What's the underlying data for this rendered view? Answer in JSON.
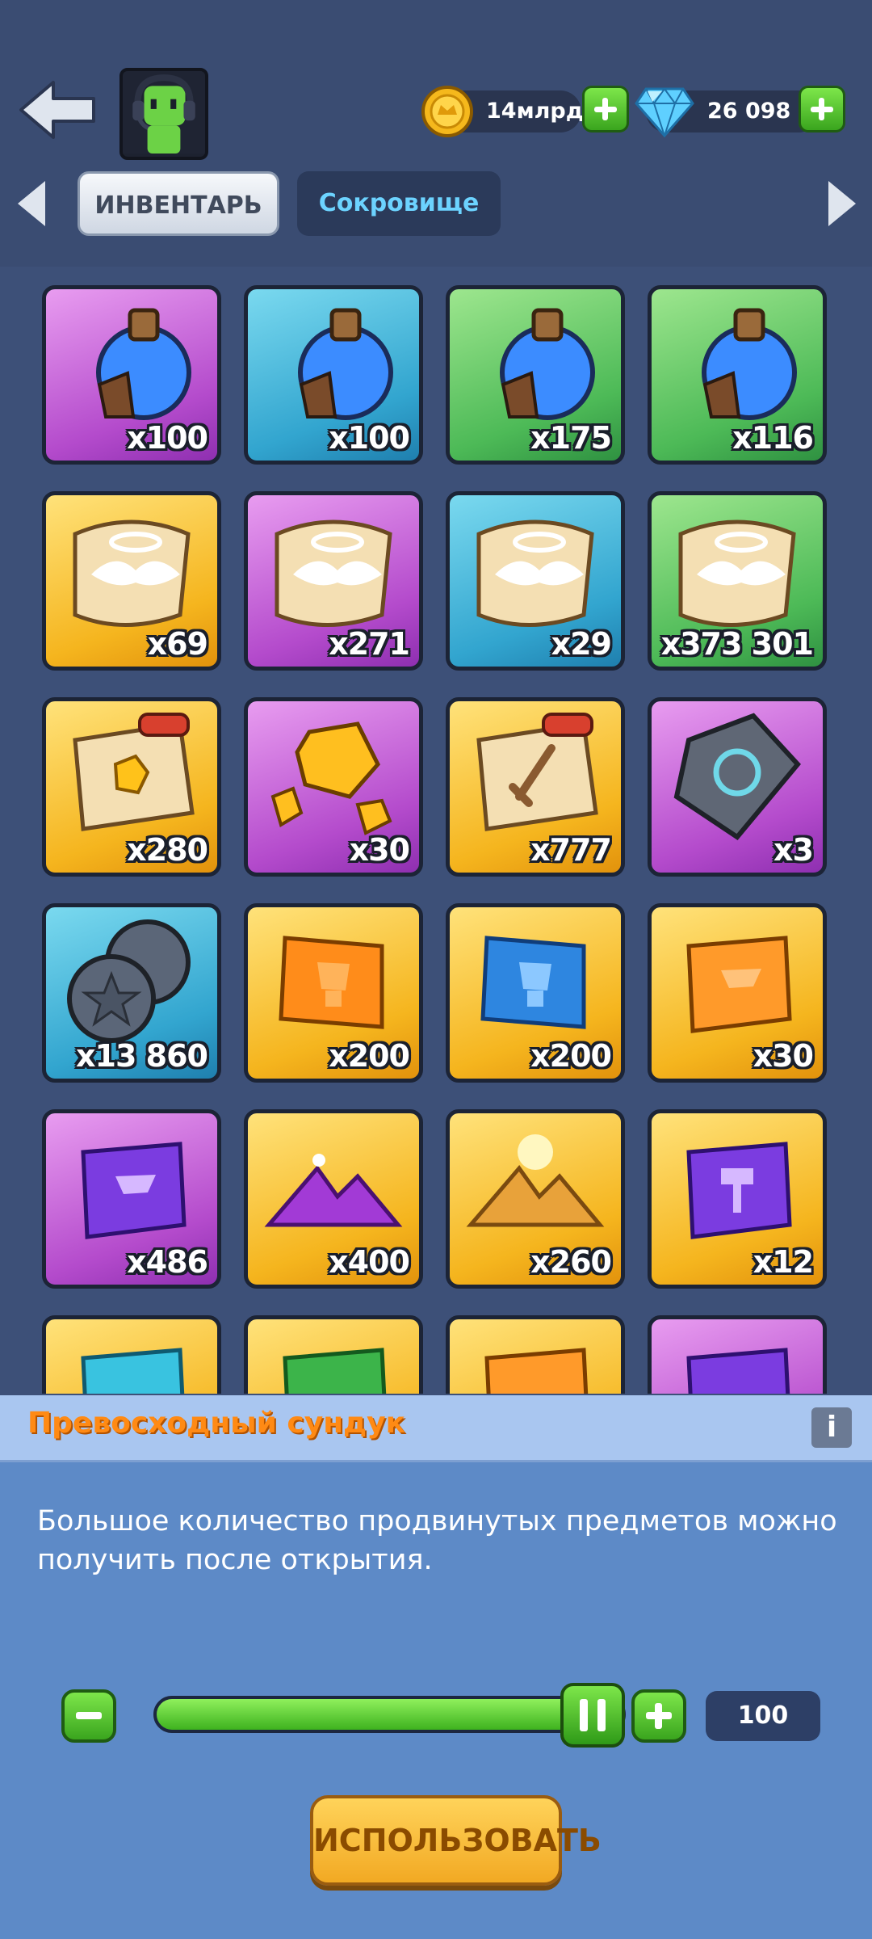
{
  "header": {
    "gold_amount": "14млрд",
    "gem_amount": "26 098"
  },
  "tabs": [
    {
      "label": "ИНВЕНТАРЬ",
      "active": true
    },
    {
      "label": "Сокровище",
      "active": false
    }
  ],
  "grid": {
    "items": [
      {
        "name": "blue-potion",
        "qty": "x100",
        "rarity": "purple",
        "icon": "potion-icon"
      },
      {
        "name": "blue-potion",
        "qty": "x100",
        "rarity": "blue",
        "icon": "potion-icon"
      },
      {
        "name": "blue-potion",
        "qty": "x175",
        "rarity": "green",
        "icon": "potion-icon"
      },
      {
        "name": "blue-potion",
        "qty": "x116",
        "rarity": "green",
        "icon": "potion-icon"
      },
      {
        "name": "winged-scroll",
        "qty": "x69",
        "rarity": "gold",
        "icon": "winged-scroll-icon"
      },
      {
        "name": "winged-scroll",
        "qty": "x271",
        "rarity": "purple",
        "icon": "winged-scroll-icon"
      },
      {
        "name": "winged-scroll",
        "qty": "x29",
        "rarity": "blue",
        "icon": "winged-scroll-icon"
      },
      {
        "name": "winged-scroll",
        "qty": "x373 301",
        "rarity": "green",
        "icon": "winged-scroll-icon"
      },
      {
        "name": "gem-scroll",
        "qty": "x280",
        "rarity": "gold",
        "icon": "gem-scroll-icon"
      },
      {
        "name": "gold-ore",
        "qty": "x30",
        "rarity": "purple",
        "icon": "gold-ore-icon"
      },
      {
        "name": "sword-scroll",
        "qty": "x777",
        "rarity": "gold",
        "icon": "sword-scroll-icon"
      },
      {
        "name": "rune-stone",
        "qty": "x3",
        "rarity": "purple",
        "icon": "rune-stone-icon"
      },
      {
        "name": "star-coins",
        "qty": "x13 860",
        "rarity": "blue",
        "icon": "star-coin-icon"
      },
      {
        "name": "orange-trophy-scroll",
        "qty": "x200",
        "rarity": "gold",
        "icon": "trophy-scroll-icon"
      },
      {
        "name": "blue-trophy-scroll",
        "qty": "x200",
        "rarity": "gold",
        "icon": "trophy-scroll-icon"
      },
      {
        "name": "orange-anvil-scroll",
        "qty": "x30",
        "rarity": "gold",
        "icon": "anvil-scroll-icon"
      },
      {
        "name": "purple-anvil-scroll",
        "qty": "x486",
        "rarity": "purple",
        "icon": "anvil-scroll-icon"
      },
      {
        "name": "purple-dust",
        "qty": "x400",
        "rarity": "gold",
        "icon": "purple-dust-icon"
      },
      {
        "name": "gold-dust",
        "qty": "x260",
        "rarity": "gold",
        "icon": "gold-dust-icon"
      },
      {
        "name": "purple-hammer-scroll",
        "qty": "x12",
        "rarity": "gold",
        "icon": "hammer-scroll-icon"
      },
      {
        "name": "cyan-scroll",
        "qty": "",
        "rarity": "gold",
        "icon": "scroll-icon"
      },
      {
        "name": "green-scroll",
        "qty": "",
        "rarity": "gold",
        "icon": "scroll-icon"
      },
      {
        "name": "orange-scroll",
        "qty": "",
        "rarity": "gold",
        "icon": "scroll-icon"
      },
      {
        "name": "purple-scroll",
        "qty": "",
        "rarity": "purple",
        "icon": "scroll-icon"
      }
    ]
  },
  "detail": {
    "title": "Превосходный сундук",
    "info_label": "i",
    "description": "Большое количество продвинутых предметов можно получить после открытия.",
    "slider_fraction": 1.0,
    "count": "100",
    "use_label": "ИСПОЛЬЗОВАТЬ"
  },
  "colors": {
    "background": "#3d5078",
    "accent_green": "#4dc22a",
    "title_orange": "#ff8a14",
    "use_button": "#f5b72e"
  }
}
